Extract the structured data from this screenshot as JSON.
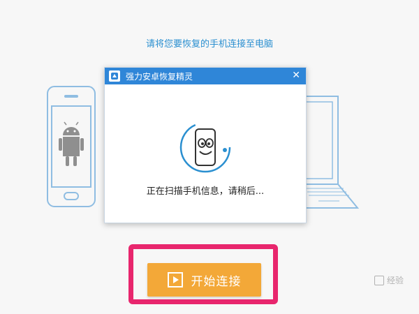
{
  "page": {
    "instruction": "请将您要恢复的手机连接至电脑",
    "start_button_label": "开始连接",
    "watermark": "经验"
  },
  "dialog": {
    "title": "强力安卓恢复精灵",
    "close_symbol": "✕",
    "status_text": "正在扫描手机信息，请稍后..."
  },
  "colors": {
    "titlebar": "#2f86d8",
    "accent_blue": "#2a8fd0",
    "button": "#f3a838",
    "highlight": "#e8266d",
    "illustration": "#8fbde2"
  },
  "icons": [
    "android-phone-icon",
    "laptop-icon",
    "app-logo-icon",
    "close-icon",
    "scanning-phone-icon",
    "play-icon"
  ]
}
